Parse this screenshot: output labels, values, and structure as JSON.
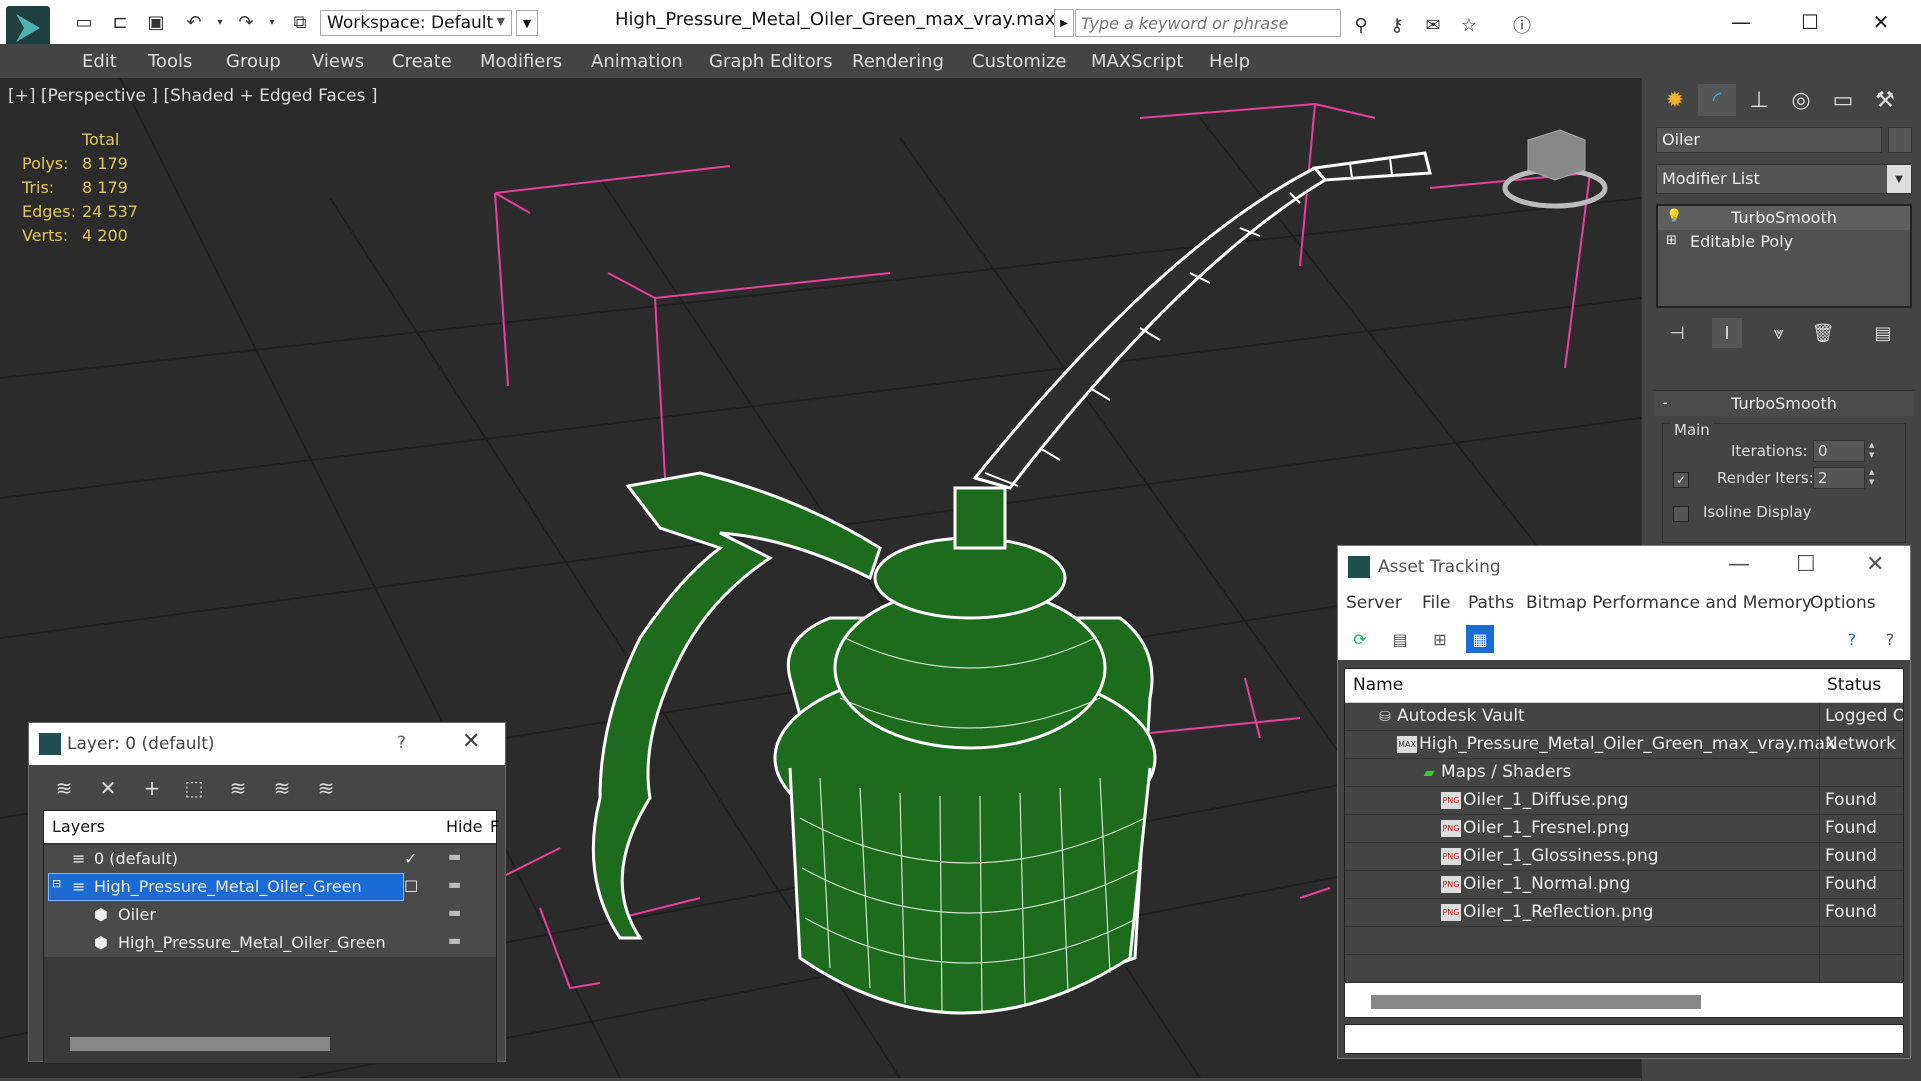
{
  "title_bar": {
    "workspace_label": "Workspace: Default",
    "document_title": "High_Pressure_Metal_Oiler_Green_max_vray.max",
    "search_placeholder": "Type a keyword or phrase"
  },
  "menu": {
    "items": [
      "Edit",
      "Tools",
      "Group",
      "Views",
      "Create",
      "Modifiers",
      "Animation",
      "Graph Editors",
      "Rendering",
      "Customize",
      "MAXScript",
      "Help"
    ]
  },
  "viewport": {
    "label": "[+] [Perspective ] [Shaded + Edged Faces ]",
    "stats": {
      "header": "Total",
      "rows": [
        {
          "label": "Polys:",
          "value": "8 179"
        },
        {
          "label": "Tris:",
          "value": "8 179"
        },
        {
          "label": "Edges:",
          "value": "24 537"
        },
        {
          "label": "Verts:",
          "value": "4 200"
        }
      ]
    },
    "colors": {
      "background": "#2b2b2b",
      "grid": "#1e1e1e",
      "bbox": "#e6409a",
      "mesh": "#1d6b1d",
      "wire": "#ffffff"
    }
  },
  "command_panel": {
    "object_name": "Oiler",
    "modifier_list_label": "Modifier List",
    "stack": [
      {
        "label": "TurboSmooth"
      },
      {
        "label": "Editable Poly"
      }
    ],
    "rollout": {
      "title": "TurboSmooth",
      "group_label": "Main",
      "iterations_label": "Iterations:",
      "iterations_value": "0",
      "render_iters_label": "Render Iters:",
      "render_iters_value": "2",
      "isoline_label": "Isoline Display"
    }
  },
  "layer_window": {
    "title": "Layer: 0 (default)",
    "help": "?",
    "col_layers": "Layers",
    "col_hide": "Hide",
    "col_f": "F",
    "rows": [
      {
        "name": "0 (default)"
      },
      {
        "name": "High_Pressure_Metal_Oiler_Green"
      },
      {
        "name": "Oiler"
      },
      {
        "name": "High_Pressure_Metal_Oiler_Green"
      }
    ]
  },
  "asset_window": {
    "title": "Asset Tracking",
    "menu": [
      "Server",
      "File",
      "Paths",
      "Bitmap Performance and Memory",
      "Options"
    ],
    "col_name": "Name",
    "col_status": "Status",
    "rows": [
      {
        "name": "Autodesk Vault",
        "status": "Logged O"
      },
      {
        "name": "High_Pressure_Metal_Oiler_Green_max_vray.max",
        "status": "Network F"
      },
      {
        "name": "Maps / Shaders",
        "status": ""
      },
      {
        "name": "Oiler_1_Diffuse.png",
        "status": "Found"
      },
      {
        "name": "Oiler_1_Fresnel.png",
        "status": "Found"
      },
      {
        "name": "Oiler_1_Glossiness.png",
        "status": "Found"
      },
      {
        "name": "Oiler_1_Normal.png",
        "status": "Found"
      },
      {
        "name": "Oiler_1_Reflection.png",
        "status": "Found"
      }
    ]
  }
}
